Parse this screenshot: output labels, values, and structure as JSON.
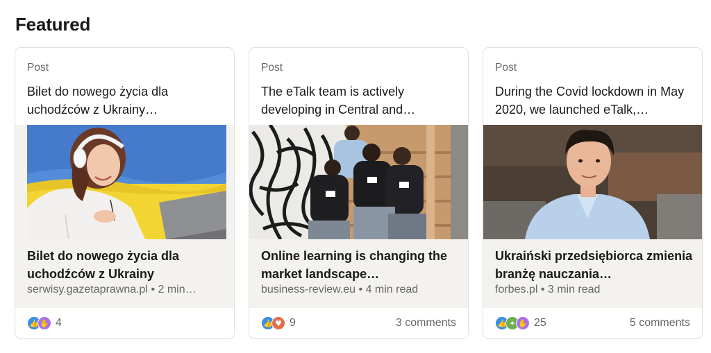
{
  "section_title": "Featured",
  "cards": [
    {
      "kind": "Post",
      "text": "Bilet do nowego życia dla uchodźców z Ukrainy…",
      "article_title": "Bilet do nowego życia dla uchodźców z Ukrainy",
      "article_meta": "serwisy.gazetaprawna.pl • 2 min…",
      "reaction_icons": [
        "like-reaction-icon",
        "support-reaction-icon"
      ],
      "reaction_count": "4",
      "comments": ""
    },
    {
      "kind": "Post",
      "text": "The eTalk team is actively developing in Central and…",
      "article_title": "Online learning is changing the market landscape…",
      "article_meta": "business-review.eu • 4 min read",
      "reaction_icons": [
        "like-reaction-icon",
        "love-reaction-icon"
      ],
      "reaction_count": "9",
      "comments": "3 comments"
    },
    {
      "kind": "Post",
      "text": "During the Covid lockdown in May 2020, we launched eTalk,…",
      "article_title": "Ukraiński przedsiębiorca zmienia branżę nauczania…",
      "article_meta": "forbes.pl • 3 min read",
      "reaction_icons": [
        "like-reaction-icon",
        "celebrate-reaction-icon",
        "support-reaction-icon"
      ],
      "reaction_count": "25",
      "comments": "5 comments"
    }
  ],
  "colors": {
    "like": "#378fe9",
    "love": "#df704d",
    "support": "#a872e8",
    "celebrate": "#6dae4f",
    "flag_blue": "#3d73c9",
    "flag_yellow": "#f2d327"
  }
}
